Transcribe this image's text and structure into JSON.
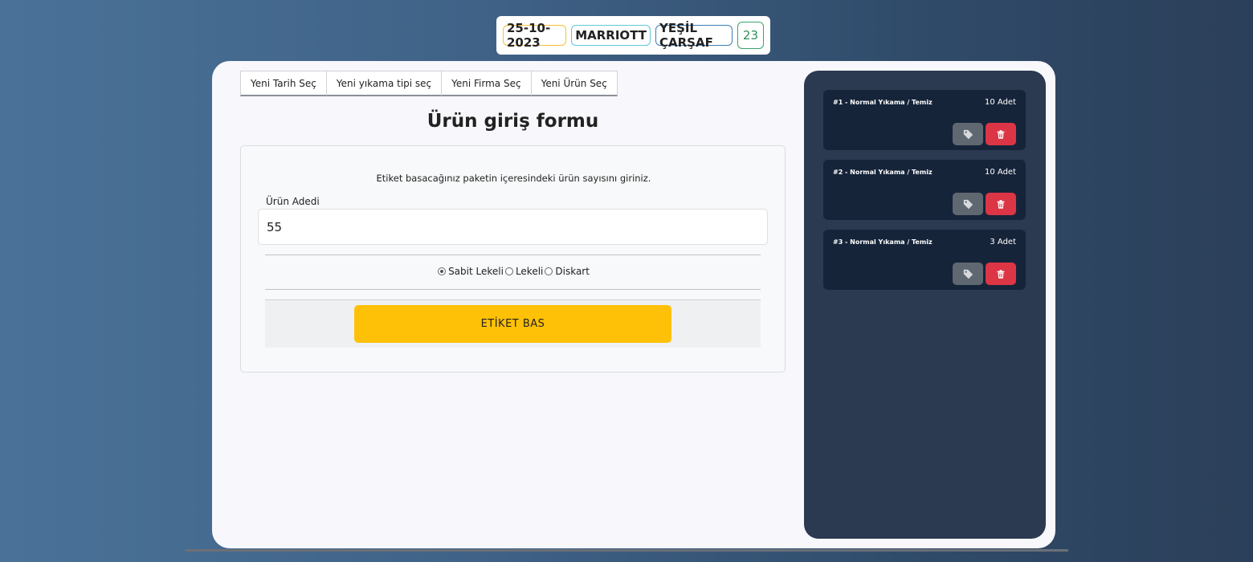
{
  "header": {
    "date": "25-10-2023",
    "firm": "MARRIOTT",
    "product": "YEŞİL ÇARŞAF",
    "count": "23"
  },
  "tabs": [
    {
      "label": "Yeni Tarih Seç"
    },
    {
      "label": "Yeni yıkama tipi seç"
    },
    {
      "label": "Yeni Firma Seç"
    },
    {
      "label": "Yeni Ürün Seç"
    }
  ],
  "form": {
    "title": "Ürün giriş formu",
    "instruction": "Etiket basacağınız paketin içeresindeki ürün sayısını giriniz.",
    "quantity_label": "Ürün Adedi",
    "quantity_value": "55",
    "radios": [
      {
        "label": "Sabit Lekeli",
        "checked": true
      },
      {
        "label": "Lekeli",
        "checked": false
      },
      {
        "label": "Diskart",
        "checked": false
      }
    ],
    "print_button": "ETİKET BAS"
  },
  "items": [
    {
      "title": "#1 - Normal Yıkama / Temiz",
      "qty": "10 Adet"
    },
    {
      "title": "#2 - Normal Yıkama / Temiz",
      "qty": "10 Adet"
    },
    {
      "title": "#3 - Normal Yıkama / Temiz",
      "qty": "3 Adet"
    }
  ],
  "icons": {
    "tag": "tag-icon",
    "delete": "trash-icon"
  },
  "colors": {
    "accent": "#ffc107",
    "danger": "#dc3545",
    "secondary": "#5f6770"
  }
}
